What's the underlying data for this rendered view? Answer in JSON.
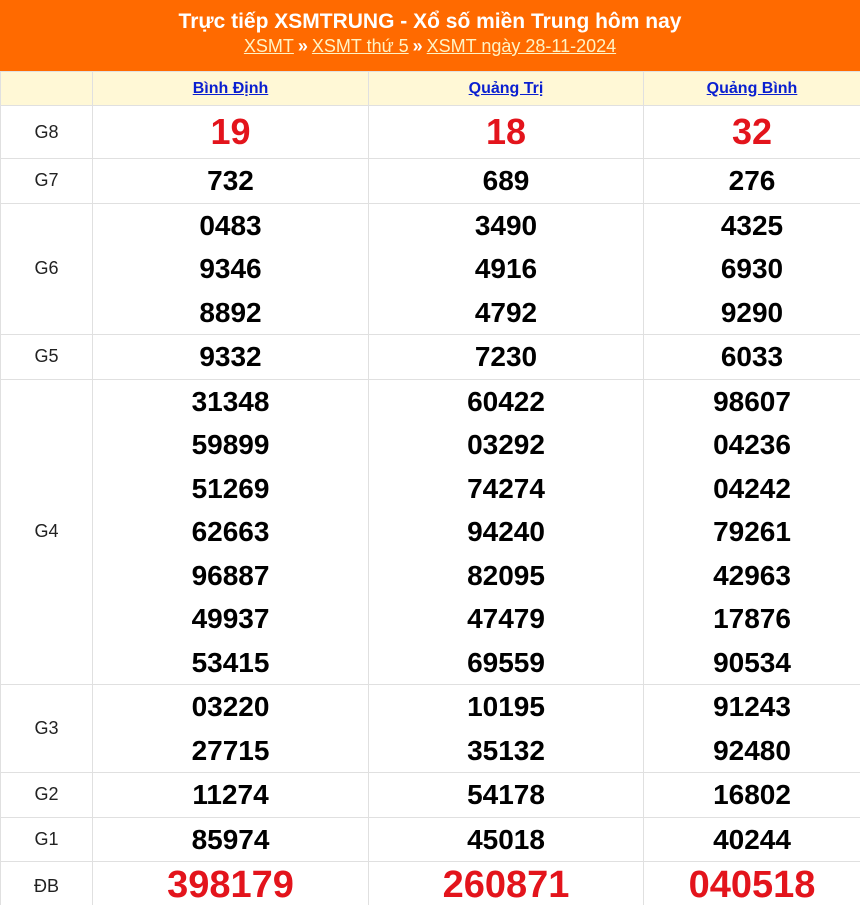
{
  "header": {
    "title": "Trực tiếp XSMTRUNG - Xổ số miền Trung hôm nay",
    "crumbs": [
      "XSMT",
      "XSMT thứ 5",
      "XSMT ngày 28-11-2024"
    ],
    "separator": "»"
  },
  "provinces": [
    "Bình Định",
    "Quảng Trị",
    "Quảng Bình"
  ],
  "prizes": [
    {
      "label": "G8",
      "key": "g8",
      "style": "red",
      "values": [
        [
          "19"
        ],
        [
          "18"
        ],
        [
          "32"
        ]
      ]
    },
    {
      "label": "G7",
      "key": "g7",
      "style": "",
      "values": [
        [
          "732"
        ],
        [
          "689"
        ],
        [
          "276"
        ]
      ]
    },
    {
      "label": "G6",
      "key": "g6",
      "style": "",
      "values": [
        [
          "0483",
          "9346",
          "8892"
        ],
        [
          "3490",
          "4916",
          "4792"
        ],
        [
          "4325",
          "6930",
          "9290"
        ]
      ]
    },
    {
      "label": "G5",
      "key": "g5",
      "style": "",
      "values": [
        [
          "9332"
        ],
        [
          "7230"
        ],
        [
          "6033"
        ]
      ]
    },
    {
      "label": "G4",
      "key": "g4",
      "style": "",
      "values": [
        [
          "31348",
          "59899",
          "51269",
          "62663",
          "96887",
          "49937",
          "53415"
        ],
        [
          "60422",
          "03292",
          "74274",
          "94240",
          "82095",
          "47479",
          "69559"
        ],
        [
          "98607",
          "04236",
          "04242",
          "79261",
          "42963",
          "17876",
          "90534"
        ]
      ]
    },
    {
      "label": "G3",
      "key": "g3",
      "style": "",
      "values": [
        [
          "03220",
          "27715"
        ],
        [
          "10195",
          "35132"
        ],
        [
          "91243",
          "92480"
        ]
      ]
    },
    {
      "label": "G2",
      "key": "g2",
      "style": "",
      "values": [
        [
          "11274"
        ],
        [
          "54178"
        ],
        [
          "16802"
        ]
      ]
    },
    {
      "label": "G1",
      "key": "g1",
      "style": "",
      "values": [
        [
          "85974"
        ],
        [
          "45018"
        ],
        [
          "40244"
        ]
      ]
    },
    {
      "label": "ĐB",
      "key": "db",
      "style": "big",
      "values": [
        [
          "398179"
        ],
        [
          "260871"
        ],
        [
          "040518"
        ]
      ]
    }
  ],
  "colors": {
    "header_bg": "#ff6a00",
    "accent_red": "#e3141c",
    "link_blue": "#0a1fd0",
    "header_row_bg": "#fff8d6"
  }
}
